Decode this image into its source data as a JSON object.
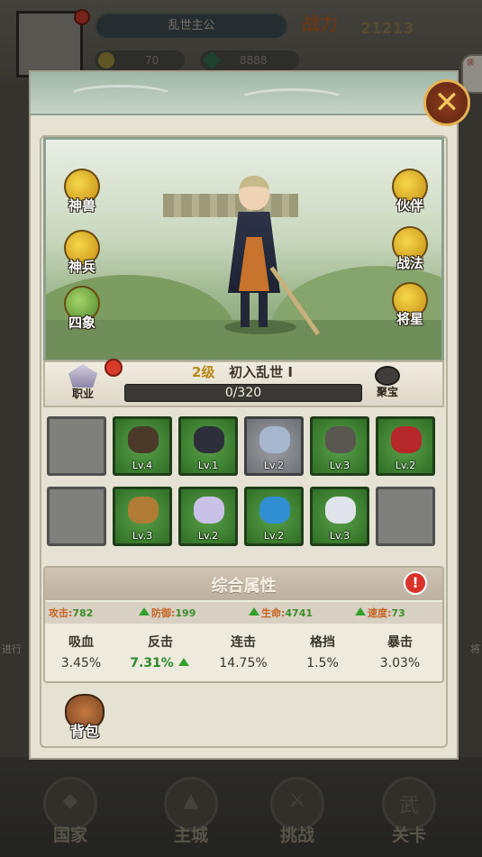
{
  "background": {
    "header_name": "乱世主公",
    "power_label": "战力",
    "power_value": "21213",
    "coins": "70",
    "gems": "8888",
    "side_badge": "领",
    "left_label": "进行",
    "right_label": "将",
    "nav": [
      {
        "label": "国家",
        "glyph": "◆"
      },
      {
        "label": "主城",
        "glyph": "▲"
      },
      {
        "label": "挑战",
        "glyph": "⚔"
      },
      {
        "label": "关卡",
        "glyph": "武"
      }
    ]
  },
  "modal": {
    "close_label": "✕",
    "scene_left_buttons": [
      {
        "label": "神兽"
      },
      {
        "label": "神兵"
      },
      {
        "label": "四象"
      }
    ],
    "scene_right_buttons": [
      {
        "label": "伙伴"
      },
      {
        "label": "战法"
      },
      {
        "label": "将星"
      }
    ],
    "class_label": "职业",
    "level_prefix": "2级",
    "level_title": "初入乱世 I",
    "xp_text": "0/320",
    "xp_fraction": 0.0,
    "badge_label": "聚宝",
    "equipment_row1": [
      {
        "type": "empty",
        "lv": ""
      },
      {
        "type": "green",
        "lv": "Lv.4",
        "item": "#4b3a2a"
      },
      {
        "type": "green",
        "lv": "Lv.1",
        "item": "#2d2f3a"
      },
      {
        "type": "gray",
        "lv": "Lv.2",
        "item": "#a7b6cf"
      },
      {
        "type": "green",
        "lv": "Lv.3",
        "item": "#5a5650"
      },
      {
        "type": "green",
        "lv": "Lv.2",
        "item": "#b6282a"
      }
    ],
    "equipment_row2": [
      {
        "type": "empty",
        "lv": ""
      },
      {
        "type": "green",
        "lv": "Lv.3",
        "item": "#b07b35"
      },
      {
        "type": "green",
        "lv": "Lv.2",
        "item": "#c9c1e8"
      },
      {
        "type": "green",
        "lv": "Lv.2",
        "item": "#2f8fd1"
      },
      {
        "type": "green",
        "lv": "Lv.3",
        "item": "#dfe3ea"
      },
      {
        "type": "empty",
        "lv": ""
      }
    ],
    "attr_title": "综合属性",
    "alert": "!",
    "main_stats": [
      {
        "label": "攻击:",
        "value": "782",
        "arrow": false
      },
      {
        "label": "防御:",
        "value": "199",
        "arrow": true
      },
      {
        "label": "生命:",
        "value": "4741",
        "arrow": true
      },
      {
        "label": "速度:",
        "value": "73",
        "arrow": true
      }
    ],
    "secondary_stats": [
      {
        "name": "吸血",
        "value": "3.45%",
        "highlight": false
      },
      {
        "name": "反击",
        "value": "7.31%",
        "highlight": true
      },
      {
        "name": "连击",
        "value": "14.75%",
        "highlight": false
      },
      {
        "name": "格挡",
        "value": "1.5%",
        "highlight": false
      },
      {
        "name": "暴击",
        "value": "3.03%",
        "highlight": false
      }
    ],
    "bag_label": "背包"
  }
}
